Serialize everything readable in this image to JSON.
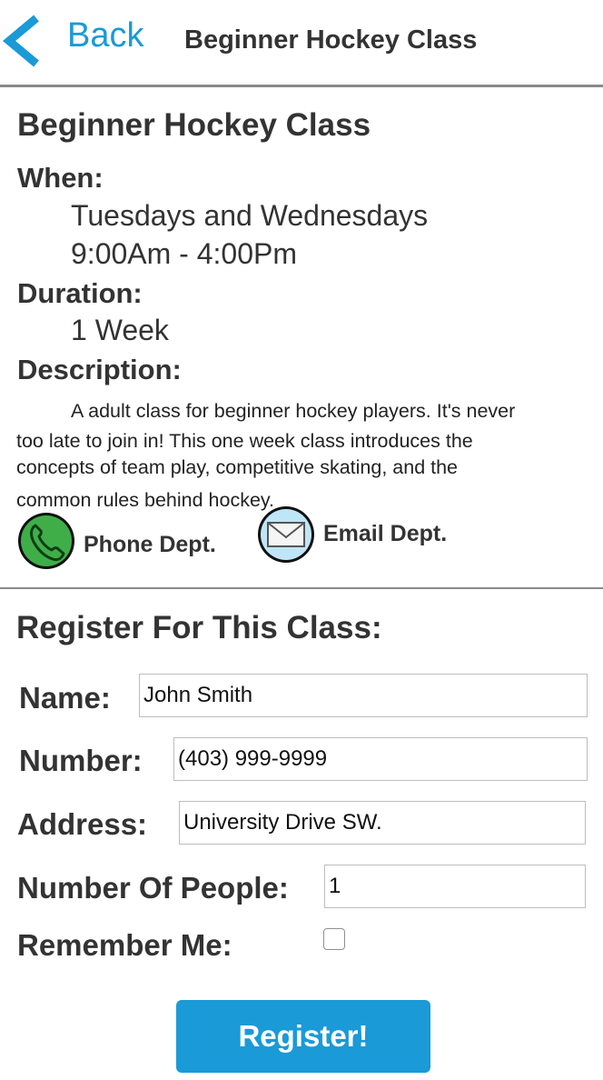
{
  "nav": {
    "back_label": "Back",
    "title": "Beginner Hockey Class"
  },
  "class_info": {
    "title": "Beginner Hockey Class",
    "when_label": "When:",
    "days": "Tuesdays and Wednesdays",
    "hours": "9:00Am - 4:00Pm",
    "duration_label": "Duration:",
    "duration": "1 Week",
    "description_label": "Description:",
    "description_line1": "A adult class for beginner hockey players. It's never",
    "description_line2": "too late to join in! This one week class introduces the",
    "description_line3": "concepts of team play, competitive skating, and the",
    "description_line4": "common rules behind hockey."
  },
  "contacts": {
    "phone_label": "Phone Dept.",
    "phone_icon": "phone-icon",
    "email_label": "Email Dept.",
    "email_icon": "envelope-icon"
  },
  "register": {
    "title": "Register For This Class:",
    "name_label": "Name:",
    "name_value": "John Smith",
    "number_label": "Number:",
    "number_value": "(403) 999-9999",
    "address_label": "Address:",
    "address_value": "University Drive SW.",
    "people_label": "Number Of People:",
    "people_value": "1",
    "remember_label": "Remember Me:",
    "remember_checked": false,
    "submit_label": "Register!"
  },
  "colors": {
    "accent": "#1a9ad6",
    "text": "#333333",
    "divider": "#8a8a8a"
  }
}
